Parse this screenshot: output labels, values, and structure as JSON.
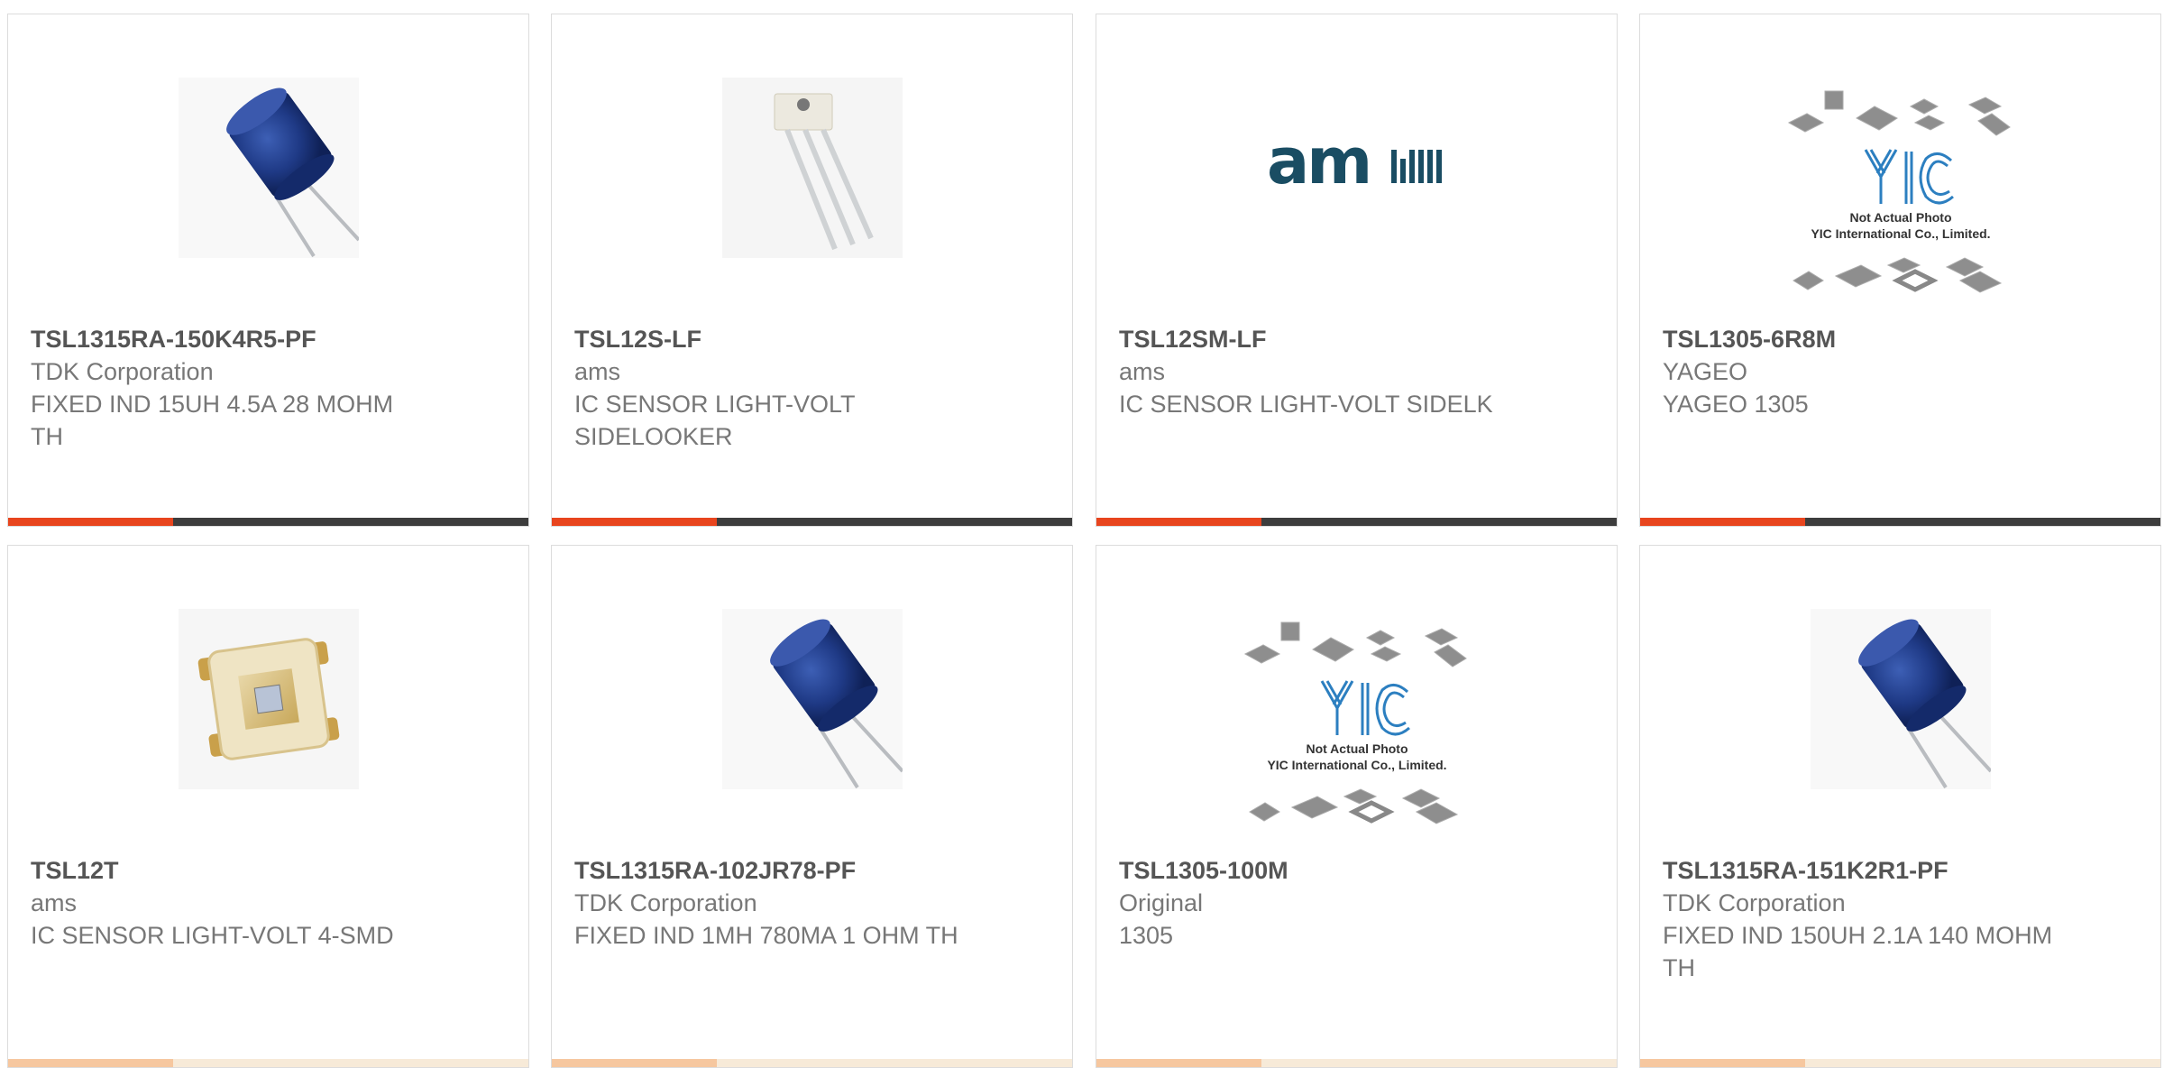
{
  "colors": {
    "accent": "#e8451e",
    "bar_dark": "#3d3d3d",
    "part_number": "#555555",
    "secondary_text": "#777777"
  },
  "products": [
    {
      "part_number": "TSL1315RA-150K4R5-PF",
      "manufacturer": "TDK Corporation",
      "description": "FIXED IND 15UH 4.5A 28 MOHM TH",
      "image": "blue-radial-inductor-icon"
    },
    {
      "part_number": "TSL12S-LF",
      "manufacturer": "ams",
      "description": "IC SENSOR LIGHT-VOLT SIDELOOKER",
      "image": "three-lead-sidelooker-sensor-icon"
    },
    {
      "part_number": "TSL12SM-LF",
      "manufacturer": "ams",
      "description": "IC SENSOR LIGHT-VOLT SIDELK",
      "image": "ams-logo",
      "logo_text": "am"
    },
    {
      "part_number": "TSL1305-6R8M",
      "manufacturer": "YAGEO",
      "description": "YAGEO 1305",
      "image": "yic-placeholder-photo",
      "placeholder_line1": "Not Actual Photo",
      "placeholder_line2": "YIC International Co., Limited."
    },
    {
      "part_number": "TSL12T",
      "manufacturer": "ams",
      "description": "IC SENSOR LIGHT-VOLT 4-SMD",
      "image": "smd-light-sensor-icon"
    },
    {
      "part_number": "TSL1315RA-102JR78-PF",
      "manufacturer": "TDK Corporation",
      "description": "FIXED IND 1MH 780MA 1 OHM TH",
      "image": "blue-radial-inductor-icon"
    },
    {
      "part_number": "TSL1305-100M",
      "manufacturer": "Original",
      "description": "1305",
      "image": "yic-placeholder-photo",
      "placeholder_line1": "Not Actual Photo",
      "placeholder_line2": "YIC International Co., Limited."
    },
    {
      "part_number": "TSL1315RA-151K2R1-PF",
      "manufacturer": "TDK Corporation",
      "description": "FIXED IND 150UH 2.1A 140 MOHM TH",
      "image": "blue-radial-inductor-icon"
    }
  ]
}
